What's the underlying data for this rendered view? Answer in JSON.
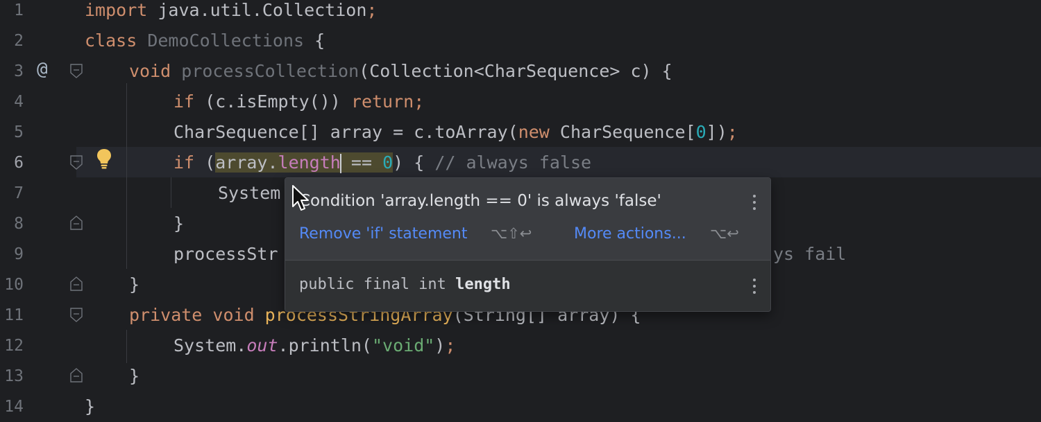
{
  "editor": {
    "line_numbers": [
      "1",
      "2",
      "3",
      "4",
      "5",
      "6",
      "7",
      "8",
      "9",
      "10",
      "11",
      "12",
      "13",
      "14"
    ],
    "tokens": {
      "import": "import",
      "import_path": " java.util.Collection",
      "semi": ";",
      "class_kw": "class",
      "class_name": " DemoCollections",
      "brace_open": " {",
      "void": "void",
      "method1": " processCollection",
      "params1": "(Collection<CharSequence> c) {",
      "if": "if",
      "cond1": " (c.isEmpty()) ",
      "return": "return",
      "semi2": ";",
      "l5_decl": "CharSequence[] array = c.toArray(",
      "new": "new",
      "l5_type": " CharSequence[",
      "zero": "0",
      "l5_end": "])",
      "semi3": ";",
      "if2": "if",
      "paren_open": " (",
      "array_ref": "array.",
      "length": "length",
      "op": " == ",
      "zero2": "0",
      "l6_end": ") { ",
      "comment": "// always false",
      "system": "System",
      "brace_close": "}",
      "process_call": "processStr",
      "call_tail": "ys fail",
      "brace_close2": "}",
      "private": "private",
      "void2": " void",
      "method2": " processStringArray",
      "params2": "(String[] array) {",
      "system2": "System.",
      "out": "out",
      "println": ".println(",
      "string": "\"void\"",
      "close_paren": ")",
      "semi4": ";",
      "brace_close3": "}",
      "brace_close4": "}"
    },
    "gutter_at": "@",
    "icons": [
      "fold-icon",
      "lightbulb-icon",
      "implements-marker-icon"
    ]
  },
  "popup": {
    "message": "Condition 'array.length == 0' is always 'false'",
    "action1": "Remove 'if' statement",
    "action1_shortcut": "⌥⇧↩",
    "action2": "More actions...",
    "action2_shortcut": "⌥↩",
    "decl_prefix": "public final int ",
    "decl_name": "length"
  },
  "colors": {
    "background": "#1e1f22",
    "keyword": "#cf8e6d",
    "link": "#548af7",
    "warning_highlight": "#4d4a2f"
  }
}
